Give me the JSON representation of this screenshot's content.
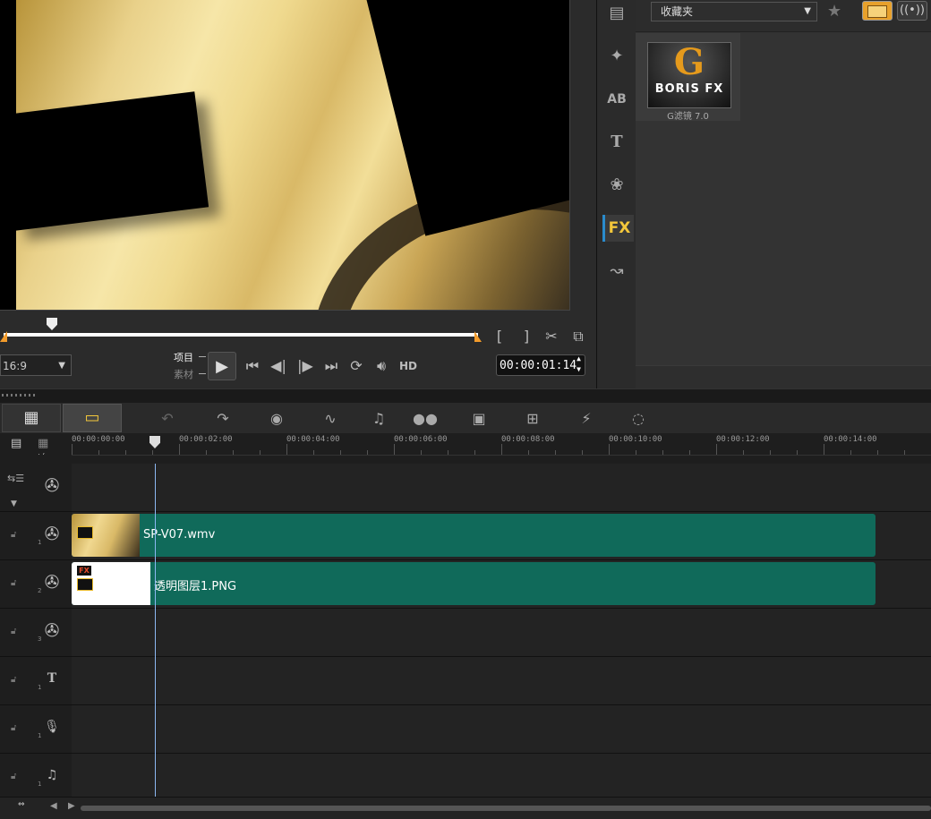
{
  "preview": {
    "aspect_ratio": "16:9",
    "mode_project": "项目",
    "mode_clip": "素材",
    "quality": "HD",
    "timecode": "00:00:01:14",
    "mark_in": "[",
    "mark_out": "]"
  },
  "library": {
    "category": "收藏夹",
    "fx_item_logo": "BORIS FX",
    "fx_item_label": "G滤镜 7.0",
    "side_icons": [
      "media-icon",
      "instant-project-icon",
      "transition-icon",
      "title-icon",
      "graphic-icon",
      "filter-icon",
      "path-icon"
    ],
    "fx_icon_text": "FX",
    "ab_icon_text": "AB",
    "title_icon_text": "T"
  },
  "timeline": {
    "ruler_labels": [
      "00:00:00:00",
      "00:00:02:00",
      "00:00:04:00",
      "00:00:06:00",
      "00:00:08:00",
      "00:00:10:00",
      "00:00:12:00",
      "00:00:14:00"
    ],
    "tracks": [
      {
        "num": "",
        "icon": "film-reel-icon"
      },
      {
        "num": "1",
        "icon": "film-reel-icon"
      },
      {
        "num": "2",
        "icon": "film-reel-icon"
      },
      {
        "num": "3",
        "icon": "film-reel-icon"
      },
      {
        "num": "1",
        "icon": "title-track-icon"
      },
      {
        "num": "1",
        "icon": "voice-track-icon"
      },
      {
        "num": "1",
        "icon": "music-track-icon"
      }
    ],
    "clips": [
      {
        "name": "SP-V07.wmv",
        "fx_badge": ""
      },
      {
        "name": "透明图层1.PNG",
        "fx_badge": "FX"
      }
    ],
    "track_add_label": "+/−"
  },
  "colors": {
    "clip": "#106a5a",
    "accent": "#f3c73b",
    "playhead": "#8cb8f2"
  }
}
